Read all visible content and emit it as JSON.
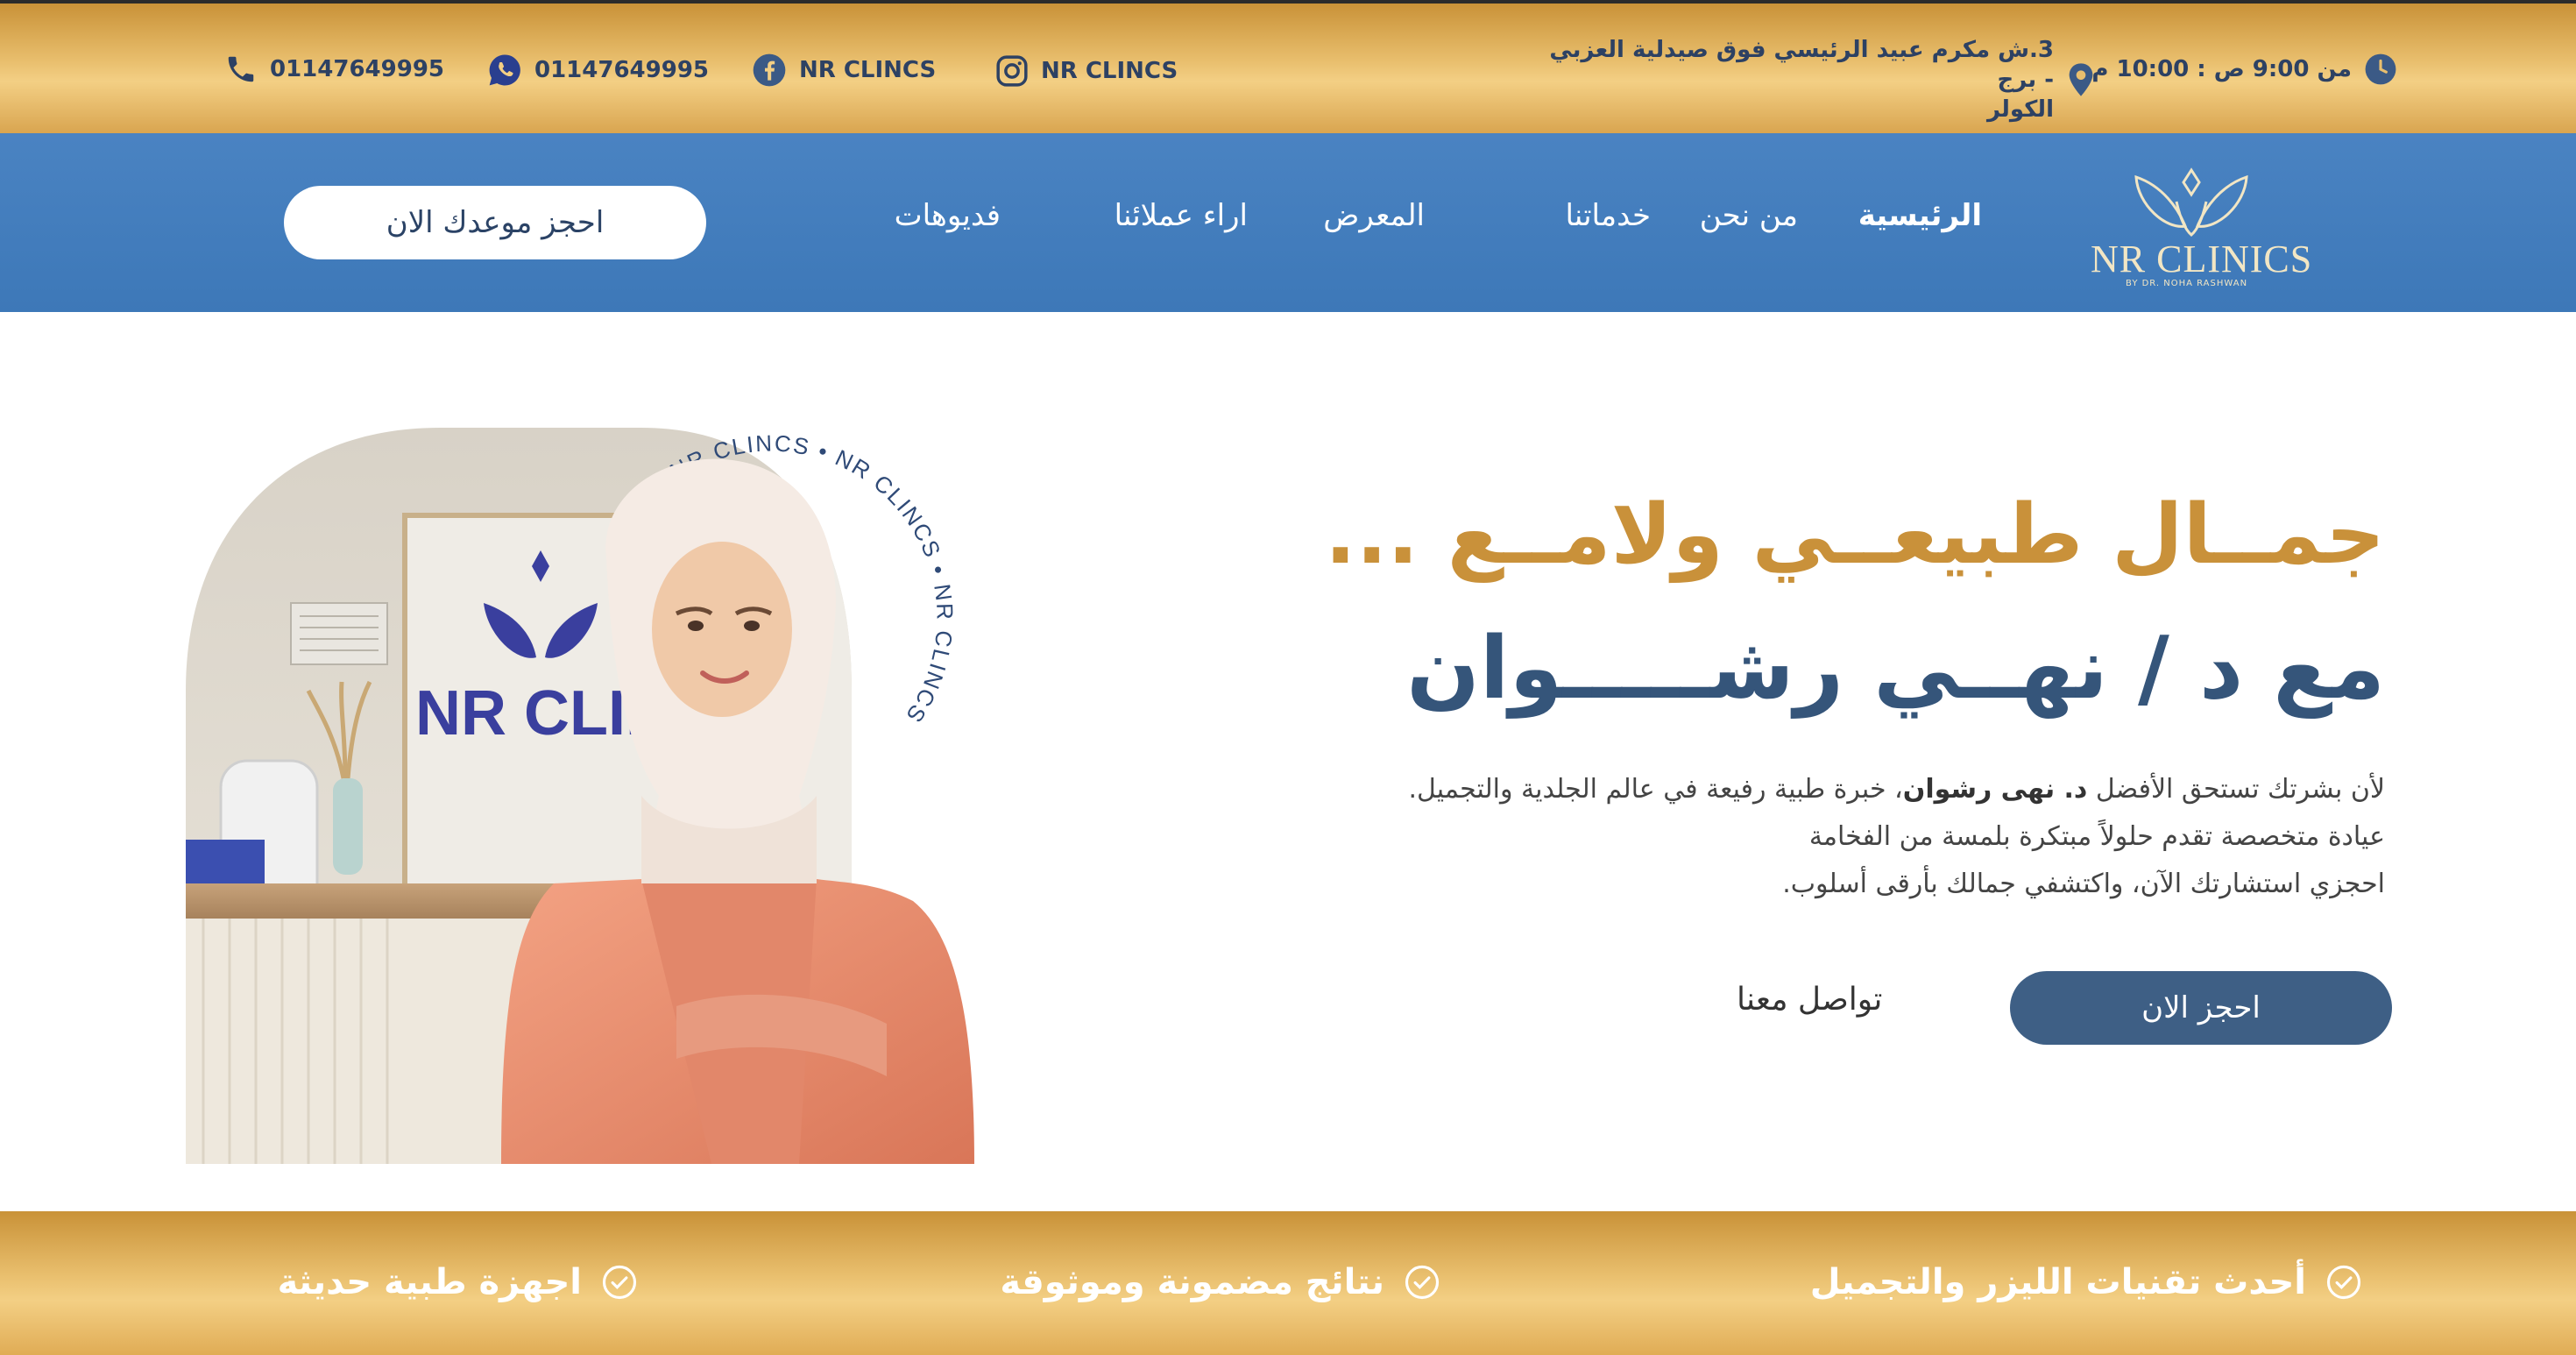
{
  "topbar": {
    "hours": "من 9:00 ص : 10:00 م",
    "address_line1": "3.ش مكرم عبيد الرئيسي فوق صيدلية العزبي - برج",
    "address_line2": "الكولر",
    "instagram": "NR CLINCS",
    "facebook": "NR CLINCS",
    "whatsapp": "01147649995",
    "phone": "01147649995",
    "icons": [
      "clock-icon",
      "location-pin-icon",
      "instagram-icon",
      "facebook-icon",
      "whatsapp-icon",
      "phone-icon"
    ]
  },
  "nav": {
    "logo_text": "NR CLINICS",
    "logo_sub": "BY DR. NOHA RASHWAN",
    "items": [
      {
        "label": "الرئيسية"
      },
      {
        "label": "من نحن"
      },
      {
        "label": "خدماتنا"
      },
      {
        "label": "المعرض"
      },
      {
        "label": "اراء عملائنا"
      },
      {
        "label": "فديوهات"
      }
    ],
    "book_button": "احجز موعدك الان"
  },
  "hero": {
    "title_line1": "جمــال طبيعــي ولامــع ...",
    "title_line2": "مع د / نهــي رشـــــوان",
    "desc_line1_a": "لأن بشرتك تستحق الأفضل",
    "desc_line1_b": "د. نهى رشوان",
    "desc_line1_c": "، خبرة طبية رفيعة في عالم الجلدية والتجميل.",
    "desc_line2": "عيادة متخصصة تقدم حلولاً مبتكرة بلمسة من الفخامة",
    "desc_line3": "احجزي استشارتك الآن، واكتشفي جمالك بأرقى أسلوب.",
    "book_now": "احجز الان",
    "contact_us": "تواصل معنا",
    "badge_text": "NR CLINCS • NR CLINCS • NR CLINCS •",
    "wall_sign": "NR CLINICS"
  },
  "features": [
    {
      "label": "أحدث تقنيات الليزر والتجميل"
    },
    {
      "label": "نتائج مضمونة وموثوقة"
    },
    {
      "label": "اجهزة طبية حديثة"
    }
  ],
  "colors": {
    "gold": "#c9913a",
    "navy": "#35557a",
    "nav_blue": "#4580bf",
    "button_navy": "#3e5f85"
  }
}
